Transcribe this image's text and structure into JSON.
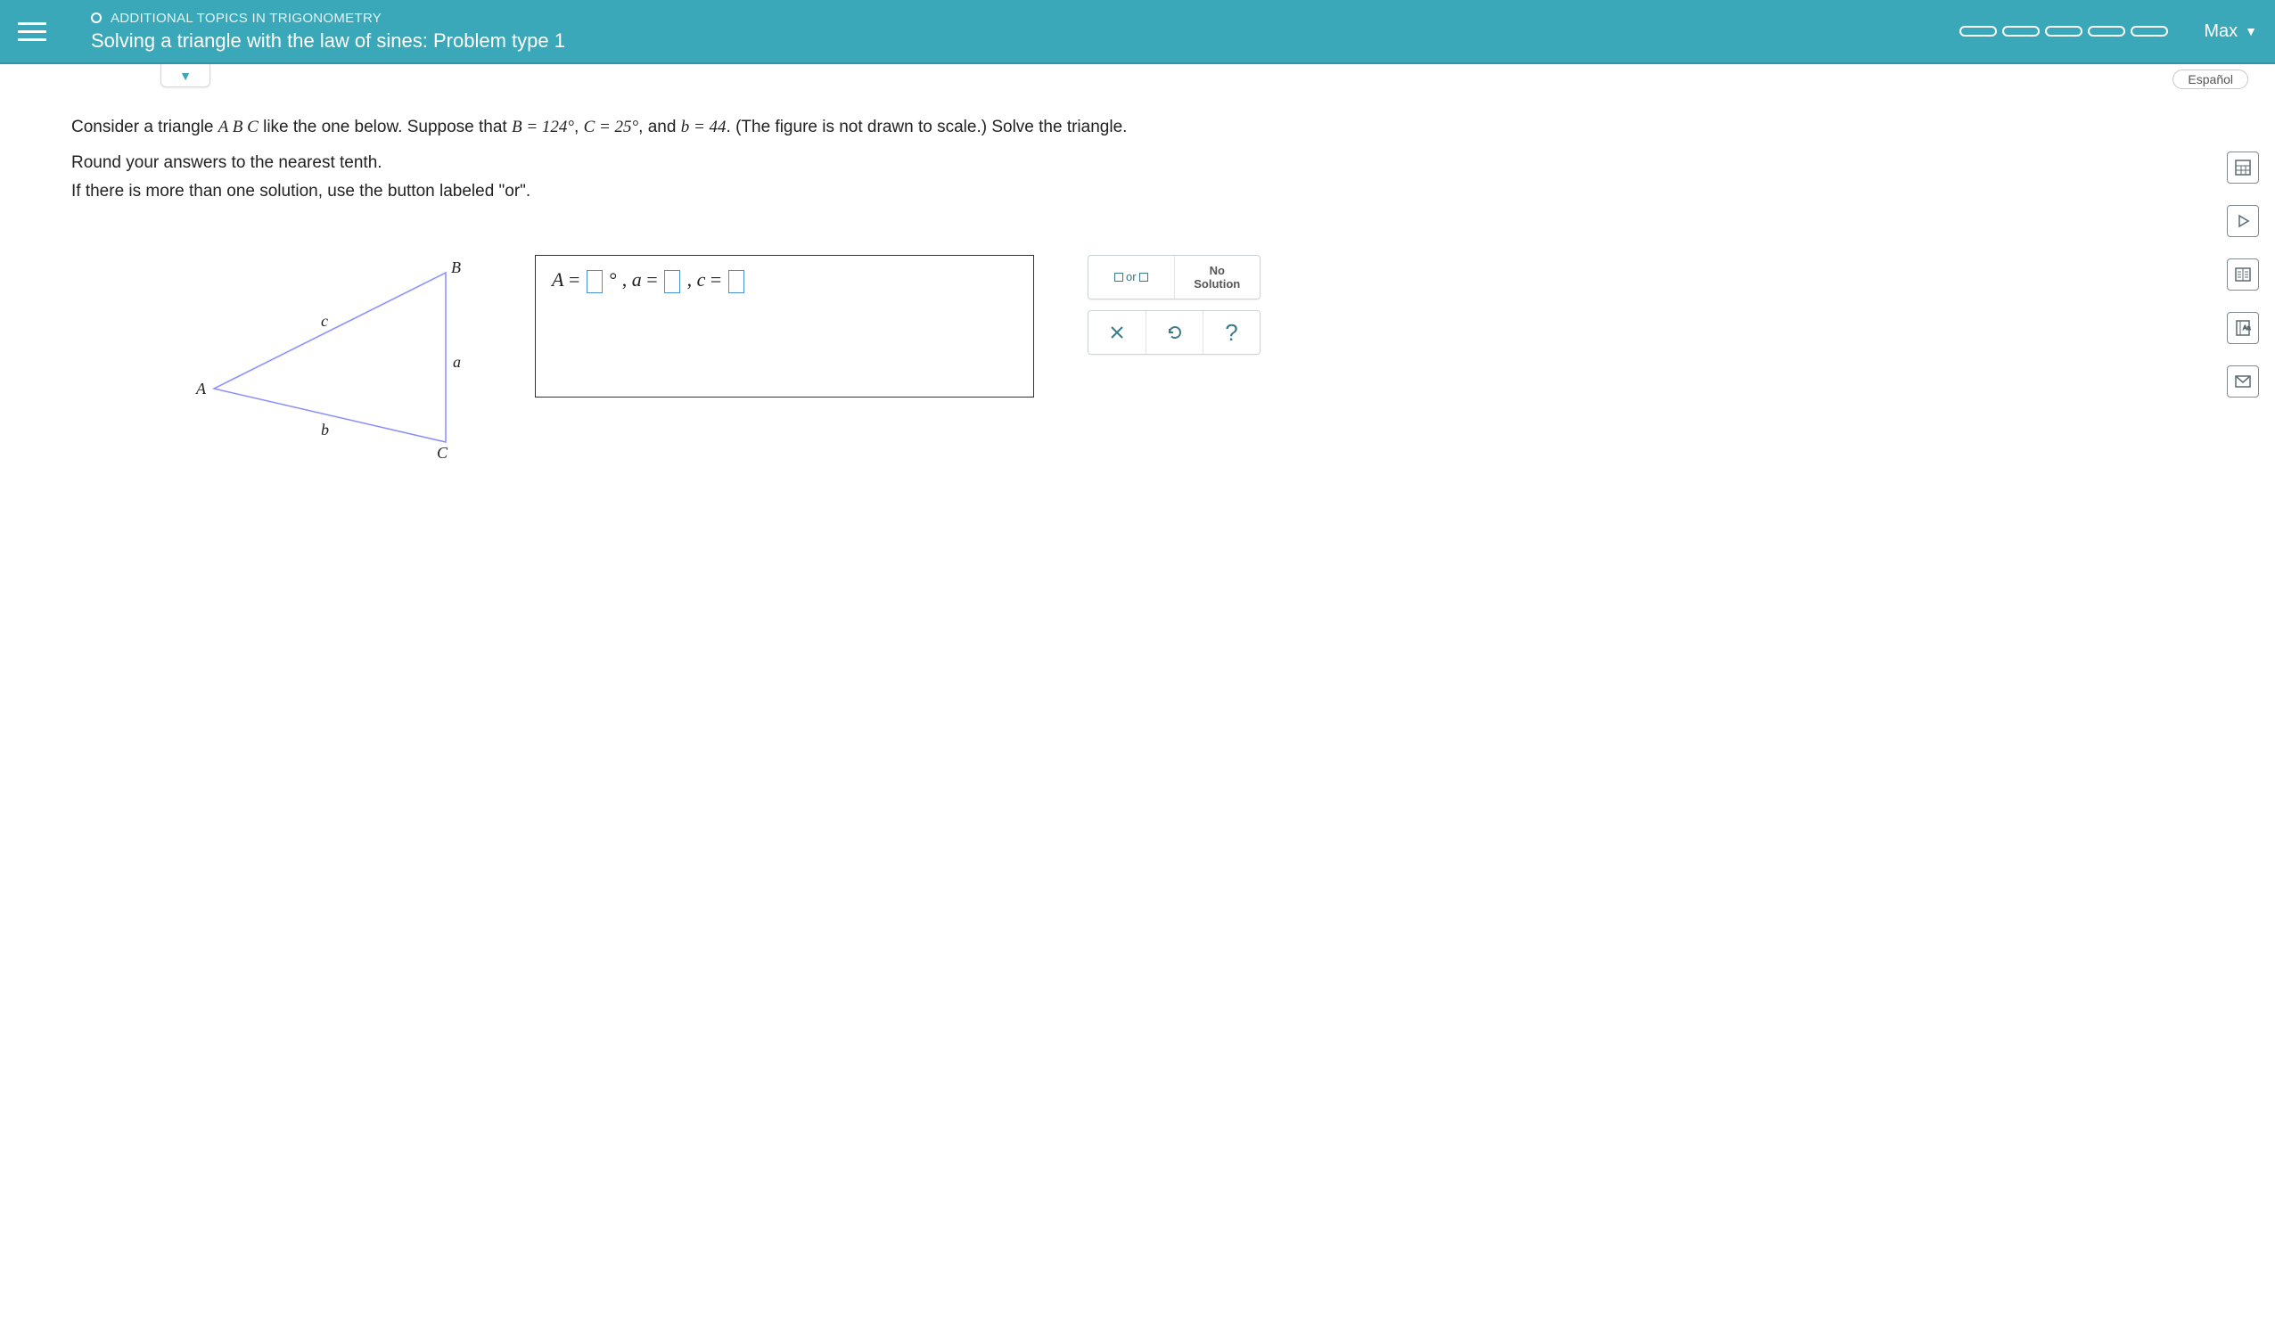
{
  "header": {
    "breadcrumb": "ADDITIONAL TOPICS IN TRIGONOMETRY",
    "title": "Solving a triangle with the law of sines: Problem type 1",
    "user": "Max"
  },
  "lang_button": "Español",
  "question": {
    "prefix": "Consider a triangle ",
    "tri": "A B C",
    "mid1": " like the one below. Suppose that ",
    "B_eq": "B = 124°",
    "sep1": ", ",
    "C_eq": "C = 25°",
    "sep2": ", and ",
    "b_eq": "b = 44",
    "suffix": ". (The figure is not drawn to scale.) Solve the triangle."
  },
  "instructions": {
    "line1": "Round your answers to the nearest tenth.",
    "line2": "If there is more than one solution, use the button labeled \"or\"."
  },
  "figure_labels": {
    "A": "A",
    "B": "B",
    "C": "C",
    "a": "a",
    "b": "b",
    "c": "c"
  },
  "answer": {
    "A_label": "A",
    "eq": " = ",
    "deg": "°",
    "comma": ", ",
    "a_label": "a",
    "c_label": "c",
    "A_value": "",
    "a_value": "",
    "c_value": ""
  },
  "tools": {
    "or_label": "or",
    "no_solution_l1": "No",
    "no_solution_l2": "Solution",
    "clear": "×",
    "undo": "↺",
    "help": "?"
  }
}
